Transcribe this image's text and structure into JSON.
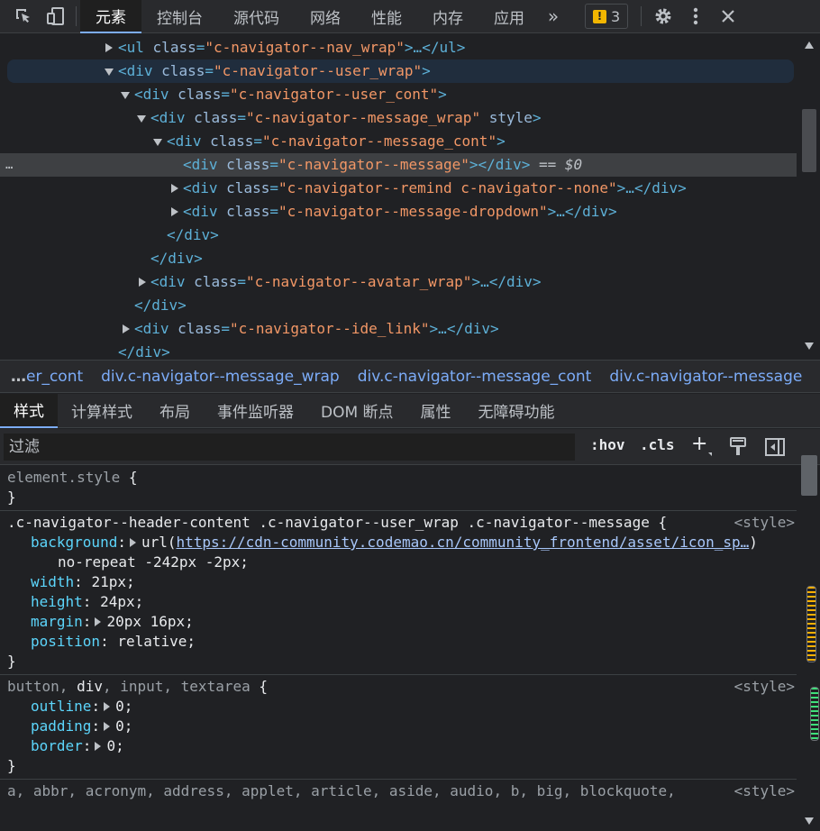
{
  "toolbar": {
    "tabs": [
      "元素",
      "控制台",
      "源代码",
      "网络",
      "性能",
      "内存",
      "应用"
    ],
    "more": "»",
    "issues_count": "3",
    "issues_icon": "!"
  },
  "tree": {
    "rows": [
      {
        "tag_open": "<ul",
        "attr": "class",
        "val": "\"c-navigator--nav_wrap\"",
        "tail": ">…</ul>"
      },
      {
        "tag_open": "<div",
        "attr": "class",
        "val": "\"c-navigator--user_wrap\"",
        "tail": ">"
      },
      {
        "tag_open": "<div",
        "attr": "class",
        "val": "\"c-navigator--user_cont\"",
        "tail": ">"
      },
      {
        "tag_open": "<div",
        "attr": "class",
        "val": "\"c-navigator--message_wrap\"",
        "extra": " style",
        "tail": ">"
      },
      {
        "tag_open": "<div",
        "attr": "class",
        "val": "\"c-navigator--message_cont\"",
        "tail": ">"
      },
      {
        "tag_open": "<div",
        "attr": "class",
        "val": "\"c-navigator--message\"",
        "tail": "></div>",
        "eq": " == $0"
      },
      {
        "tag_open": "<div",
        "attr": "class",
        "val": "\"c-navigator--remind c-navigator--none\"",
        "tail": ">…</div>"
      },
      {
        "tag_open": "<div",
        "attr": "class",
        "val": "\"c-navigator--message-dropdown\"",
        "tail": ">…</div>"
      },
      {
        "close": "</div>"
      },
      {
        "close": "</div>"
      },
      {
        "tag_open": "<div",
        "attr": "class",
        "val": "\"c-navigator--avatar_wrap\"",
        "tail": ">…</div>"
      },
      {
        "close": "</div>"
      },
      {
        "tag_open": "<div",
        "attr": "class",
        "val": "\"c-navigator--ide_link\"",
        "tail": ">…</div>"
      },
      {
        "close": "</div>"
      }
    ],
    "selected_dots": "…"
  },
  "breadcrumb": {
    "left_ellipsis": "…",
    "items": [
      "er_cont",
      "div.c-navigator--message_wrap",
      "div.c-navigator--message_cont",
      "div.c-navigator--message"
    ],
    "right_ellipsis": "…"
  },
  "subtabs": [
    "样式",
    "计算样式",
    "布局",
    "事件监听器",
    "DOM 断点",
    "属性",
    "无障碍功能"
  ],
  "filter": {
    "placeholder": "过滤",
    "hov": ":hov",
    "cls": ".cls",
    "add": "+"
  },
  "styles": {
    "element_style": {
      "selector": "element.style",
      "open": " {",
      "close": "}"
    },
    "rule1": {
      "selector": ".c-navigator--header-content .c-navigator--user_wrap .c-navigator--message",
      "open": " {",
      "source": "<style>",
      "bg_prop": "background",
      "bg_url_prefix": "url(",
      "bg_url": "https://cdn-community.codemao.cn/community_frontend/asset/icon_sp…",
      "bg_url_suffix": ")",
      "bg_rest": "no-repeat -242px -2px;",
      "decls": [
        {
          "prop": "width",
          "val": "21px;"
        },
        {
          "prop": "height",
          "val": "24px;"
        },
        {
          "prop": "margin",
          "val": "20px 16px;",
          "expand": true
        },
        {
          "prop": "position",
          "val": "relative;"
        }
      ],
      "close": "}"
    },
    "rule2": {
      "sel_dim1": "button, ",
      "sel_match": "div",
      "sel_dim2": ", input, textarea",
      "open": " {",
      "source": "<style>",
      "decls": [
        {
          "prop": "outline",
          "val": "0;"
        },
        {
          "prop": "padding",
          "val": "0;"
        },
        {
          "prop": "border",
          "val": "0;"
        }
      ],
      "close": "}"
    },
    "rule3": {
      "selector": "a, abbr, acronym, address, applet, article, aside, audio, b, big, blockquote,",
      "source": "<style>"
    }
  }
}
